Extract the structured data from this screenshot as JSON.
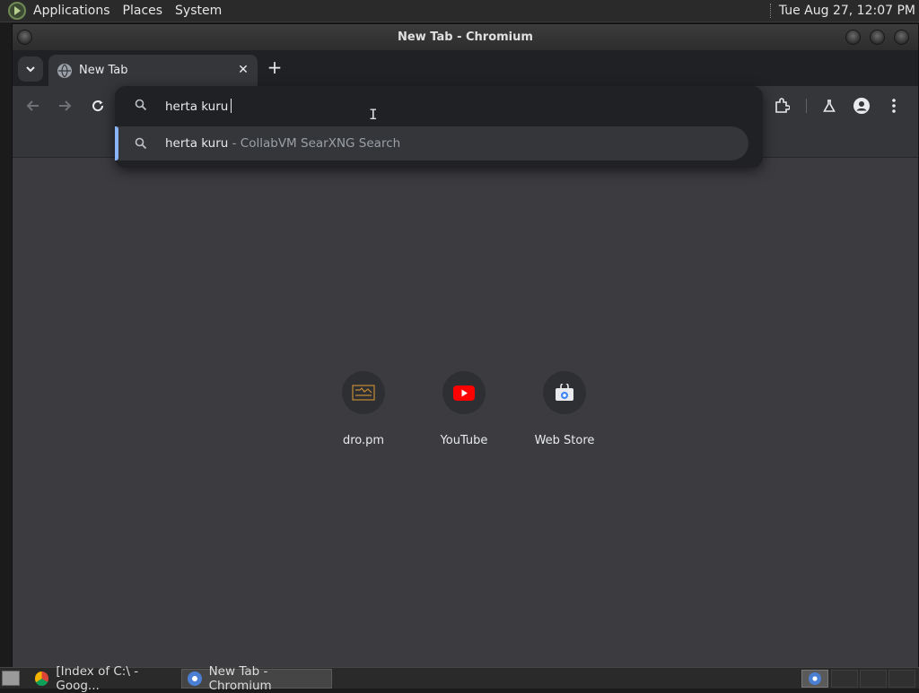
{
  "top_panel": {
    "menus": [
      "Applications",
      "Places",
      "System"
    ],
    "clock": "Tue Aug 27, 12:07 PM"
  },
  "window": {
    "title": "New Tab - Chromium"
  },
  "tabs": [
    {
      "label": "New Tab",
      "icon": "globe-icon"
    }
  ],
  "omnibox": {
    "input_value": "herta kuru",
    "suggestion_query": "herta kuru",
    "suggestion_desc": " - CollabVM SearXNG Search"
  },
  "shortcuts": [
    {
      "label": "dro.pm",
      "icon": "dro-pm-icon"
    },
    {
      "label": "YouTube",
      "icon": "youtube-icon"
    },
    {
      "label": "Web Store",
      "icon": "web-store-icon"
    }
  ],
  "taskbar": {
    "tasks": [
      {
        "label": "[Index of C:\\ - Goog..."
      },
      {
        "label": "New Tab - Chromium"
      }
    ]
  },
  "colors": {
    "accent": "#8ab4f8",
    "content_bg": "#3c3c40",
    "youtube_red": "#ff0000"
  }
}
